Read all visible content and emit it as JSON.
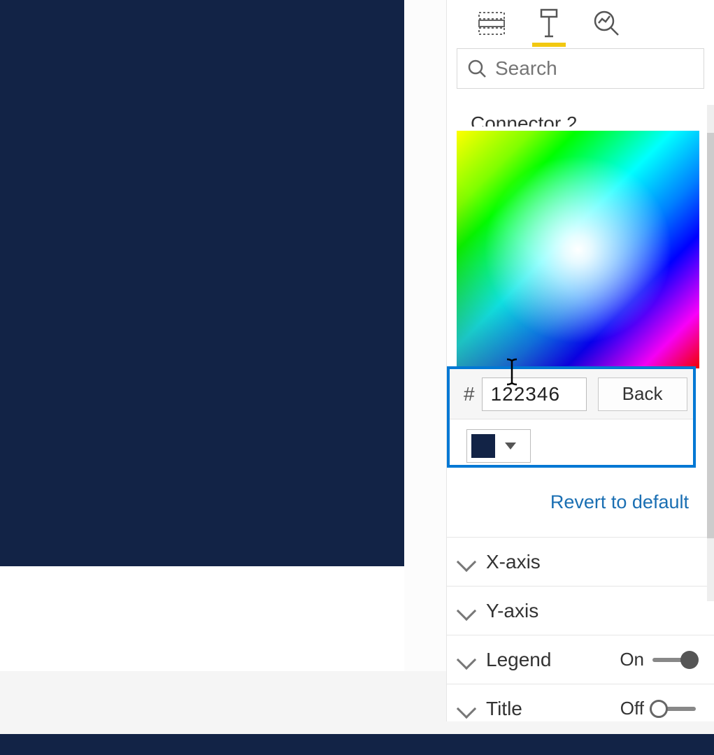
{
  "search": {
    "placeholder": "Search"
  },
  "partial_section_label": "Connector 2",
  "hex": {
    "hash": "#",
    "value": "122346",
    "back_label": "Back",
    "swatch_color": "#122346"
  },
  "revert_label": "Revert to default",
  "sections": {
    "xaxis": {
      "label": "X-axis"
    },
    "yaxis": {
      "label": "Y-axis"
    },
    "legend": {
      "label": "Legend",
      "toggle_text": "On"
    },
    "title": {
      "label": "Title",
      "toggle_text": "Off"
    }
  }
}
